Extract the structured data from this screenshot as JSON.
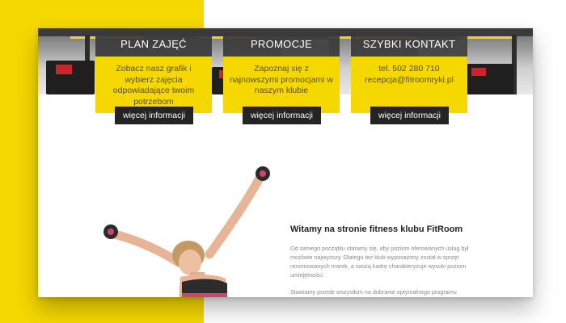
{
  "colors": {
    "accent": "#f5d800",
    "dark": "#3a3a3a",
    "button": "#242424"
  },
  "columns": [
    {
      "title": "PLAN ZAJĘĆ",
      "text": "Zobacz nasz grafik i wybierz zajęcia odpowiadające twoim potrzebom",
      "button": "więcej informacji"
    },
    {
      "title": "PROMOCJE",
      "text": "Zapoznaj się z najnowszymi promocjami w naszym klubie",
      "button": "więcej informacji"
    },
    {
      "title": "SZYBKI KONTAKT",
      "text": "tel. 502 280 710 recepcja@fitroomryki.pl",
      "button": "więcej informacji"
    }
  ],
  "welcome": {
    "title": "Witamy na stronie fitness klubu FitRoom",
    "paragraph1": "Od samego początku staramy się, aby poziom oferowanych usług był możliwie najwyższy. Dlatego też klub wyposażony został w sprzęt renomowanych marek, a naszą kadrę charakteryzuje wysoki poziom umiejętności.",
    "paragraph2": "Stawiamy przede wszystkim na dobranie optymalnego programu treningowego, który ustalany jest każdorazowo podczas indywidualnej"
  }
}
